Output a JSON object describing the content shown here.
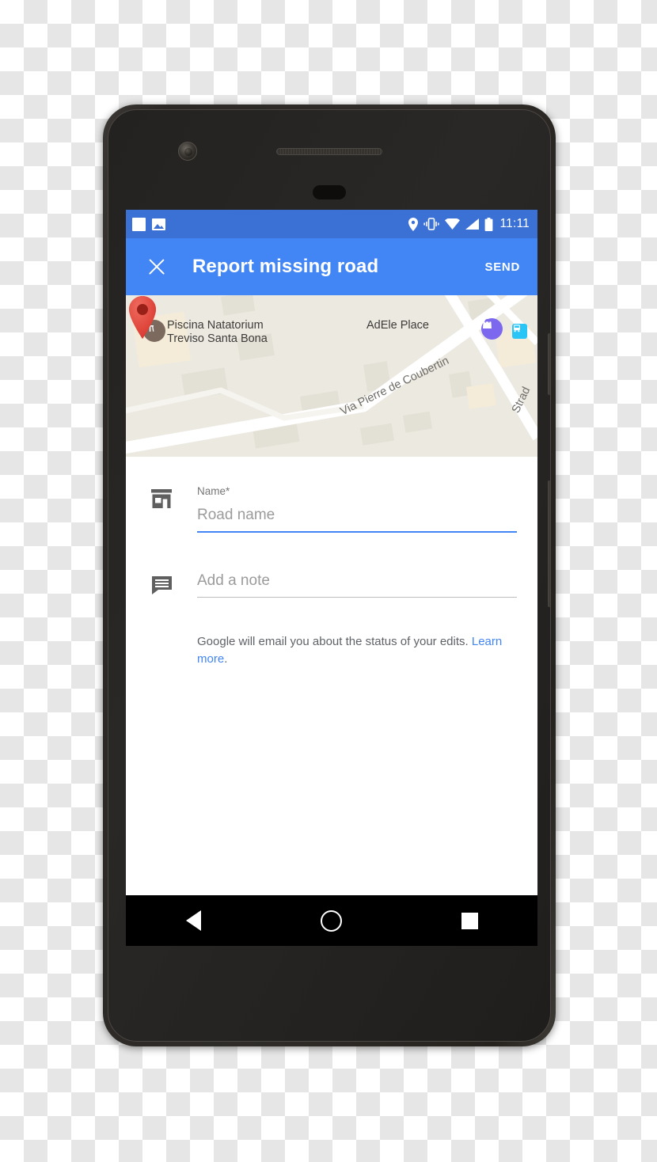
{
  "status_bar": {
    "left_icons": [
      "blank-square-icon",
      "screenshot-image-icon"
    ],
    "right_icons": [
      "location-pin-icon",
      "vibrate-icon",
      "wifi-icon",
      "signal-icon",
      "battery-icon"
    ],
    "time": "11:11"
  },
  "app_bar": {
    "close_icon": "close-icon",
    "title": "Report missing road",
    "send_label": "SEND"
  },
  "map": {
    "pin_icon": "map-pin-icon",
    "places": [
      {
        "name": "Piscina Natatorium",
        "name_line2": "Treviso Santa Bona",
        "icon": "attraction-icon"
      },
      {
        "name": "AdEle Place",
        "icon": "shopping-bag-icon"
      }
    ],
    "transit_icon": "bus-stop-icon",
    "roads": [
      "Via Pierre de Coubertin",
      "Strad"
    ]
  },
  "form": {
    "name_field": {
      "icon": "storefront-icon",
      "label": "Name*",
      "placeholder": "Road name",
      "value": ""
    },
    "note_field": {
      "icon": "comment-icon",
      "label": "",
      "placeholder": "Add a note",
      "value": ""
    },
    "disclaimer": "Google will email you about the status of your edits. ",
    "disclaimer_link": "Learn more",
    "disclaimer_end": "."
  },
  "nav_bar": {
    "back_icon": "back-triangle-icon",
    "home_icon": "home-circle-icon",
    "recents_icon": "recents-square-icon"
  },
  "device": {
    "camera_icon": "front-camera-icon",
    "speaker_icon": "earpiece-speaker-icon",
    "sensor_icon": "proximity-sensor-icon",
    "power_button": "power-button",
    "volume_button": "volume-rocker-button"
  },
  "colors": {
    "accent": "#4285f4",
    "status_bar": "#3b71d4",
    "map_bg": "#ece9e1",
    "pin": "#e2443b",
    "link": "#4285f4"
  }
}
